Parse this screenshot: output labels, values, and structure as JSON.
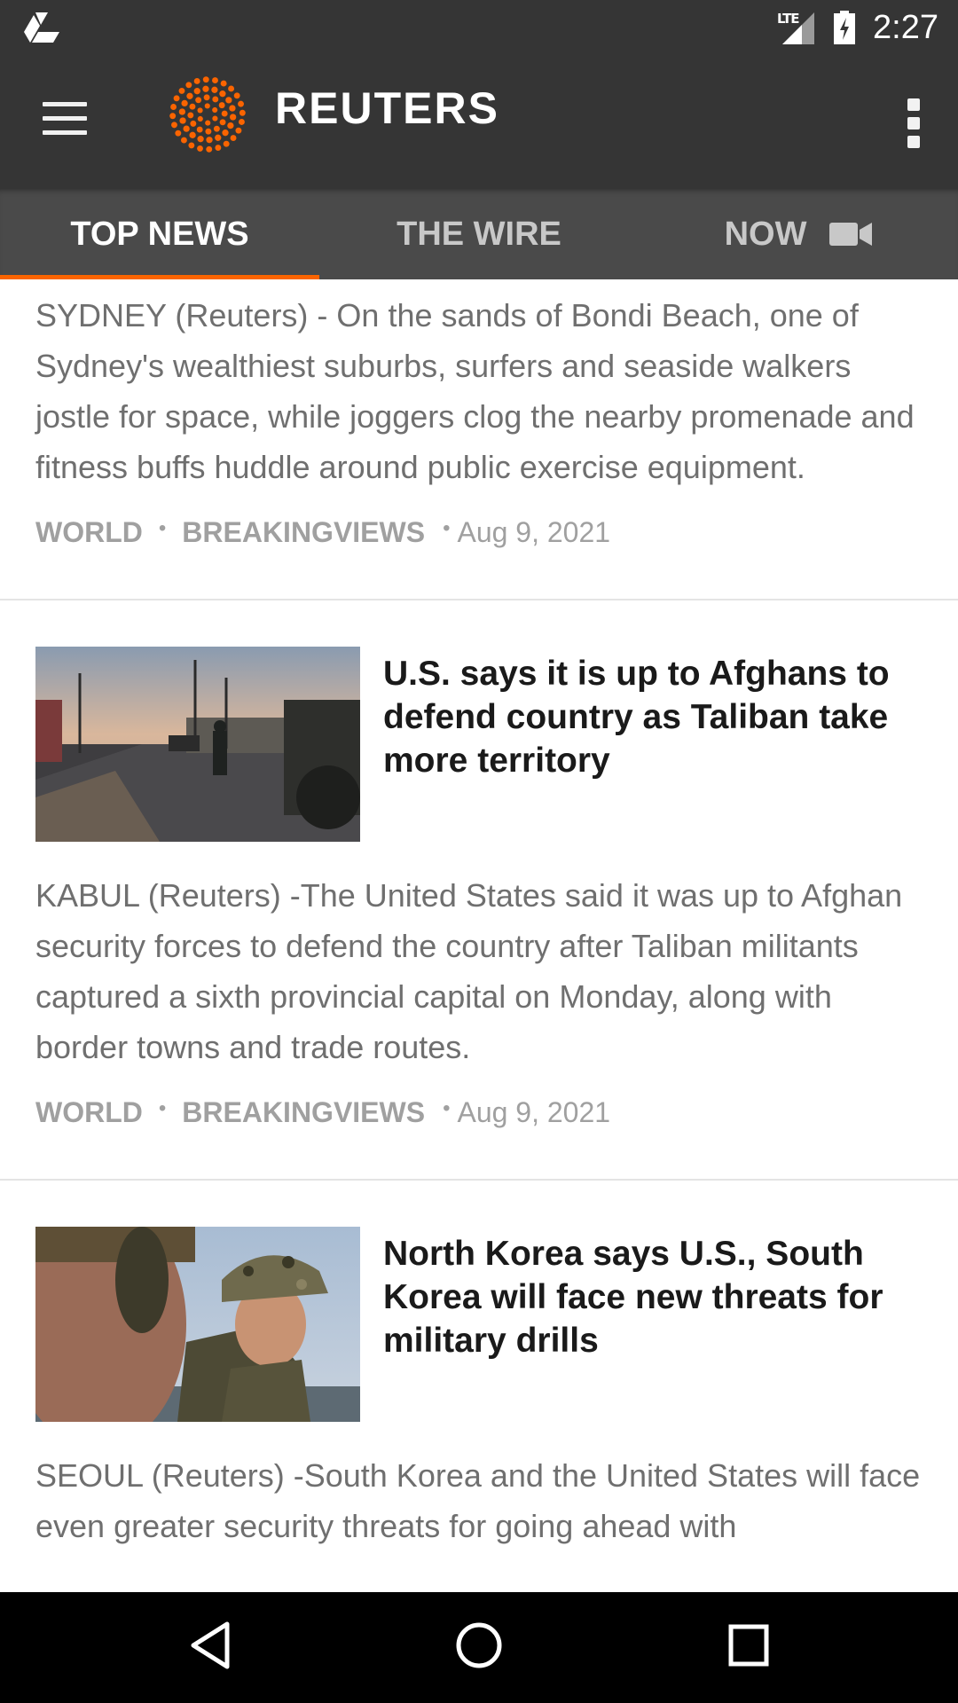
{
  "status_bar": {
    "time": "2:27",
    "network": "LTE",
    "icons": [
      "drive-icon",
      "signal-icon",
      "battery-charging-icon"
    ]
  },
  "app_bar": {
    "brand": "REUTERS",
    "brand_color": "#fa6400",
    "icons": [
      "menu-icon",
      "reuters-logo-icon",
      "overflow-menu-icon"
    ]
  },
  "tabs": [
    {
      "label": "TOP NEWS",
      "active": true
    },
    {
      "label": "THE WIRE",
      "active": false
    },
    {
      "label": "NOW",
      "active": false,
      "icon": "video-icon"
    }
  ],
  "stories": [
    {
      "summary": "SYDNEY (Reuters) -     On the sands of Bondi Beach, one of Sydney's wealthiest suburbs, surfers and seaside walkers jostle for space, while joggers clog the nearby promenade and fitness buffs huddle around public exercise equipment.",
      "category": "WORLD",
      "section": "BREAKINGVIEWS",
      "date": "Aug 9, 2021"
    },
    {
      "headline": "U.S. says it is up to Afghans to defend country as Taliban take more territory",
      "summary": "KABUL (Reuters) -The United States said it was up to Afghan security forces to defend the country after Taliban militants captured a sixth provincial capital on Monday, along with border towns and trade routes.",
      "category": "WORLD",
      "section": "BREAKINGVIEWS",
      "date": "Aug 9, 2021"
    },
    {
      "headline": "North Korea says U.S., South Korea will face new threats for military drills",
      "summary": "SEOUL (Reuters) -South Korea and the United States will face even greater security threats for going ahead with"
    }
  ],
  "nav_bar": {
    "icons": [
      "back-icon",
      "home-icon",
      "recents-icon"
    ]
  }
}
